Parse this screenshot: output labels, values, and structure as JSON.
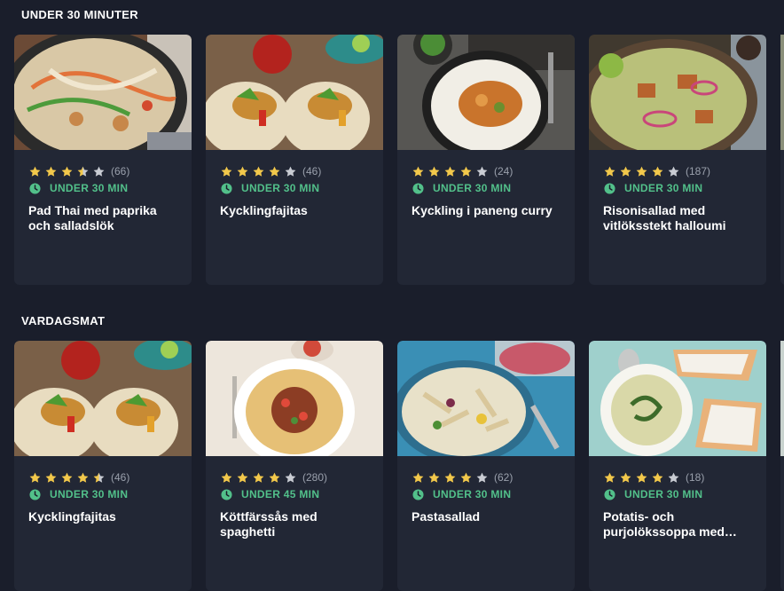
{
  "sections": [
    {
      "title": "UNDER 30 MINUTER",
      "cards": [
        {
          "image": "pad-thai-photo",
          "rating": 3.5,
          "count": "(66)",
          "time": "UNDER 30 MIN",
          "title": "Pad Thai med paprika och salladslök"
        },
        {
          "image": "kycklingfajitas-photo",
          "rating": 4,
          "count": "(46)",
          "time": "UNDER 30 MIN",
          "title": "Kycklingfajitas"
        },
        {
          "image": "paneng-curry-photo",
          "rating": 4,
          "count": "(24)",
          "time": "UNDER 30 MIN",
          "title": "Kyckling i paneng curry"
        },
        {
          "image": "risonisallad-photo",
          "rating": 4,
          "count": "(187)",
          "time": "UNDER 30 MIN",
          "title": "Risonisallad med vitlöksstekt halloumi"
        }
      ]
    },
    {
      "title": "VARDAGSMAT",
      "cards": [
        {
          "image": "kycklingfajitas-photo",
          "rating": 4.5,
          "count": "(46)",
          "time": "UNDER 30 MIN",
          "title": "Kycklingfajitas"
        },
        {
          "image": "kottfarssas-photo",
          "rating": 4,
          "count": "(280)",
          "time": "UNDER 45 MIN",
          "title": "Köttfärssås med spaghetti"
        },
        {
          "image": "pastasallad-photo",
          "rating": 4,
          "count": "(62)",
          "time": "UNDER 30 MIN",
          "title": "Pastasallad"
        },
        {
          "image": "potatissoppa-photo",
          "rating": 4,
          "count": "(18)",
          "time": "UNDER 30 MIN",
          "title": "Potatis- och purjolökssoppa med…"
        }
      ]
    }
  ],
  "colors": {
    "background": "#1a1e2b",
    "card": "#222735",
    "star_filled": "#f2c84b",
    "star_empty": "#c9ccd3",
    "time_green": "#52c08a"
  }
}
